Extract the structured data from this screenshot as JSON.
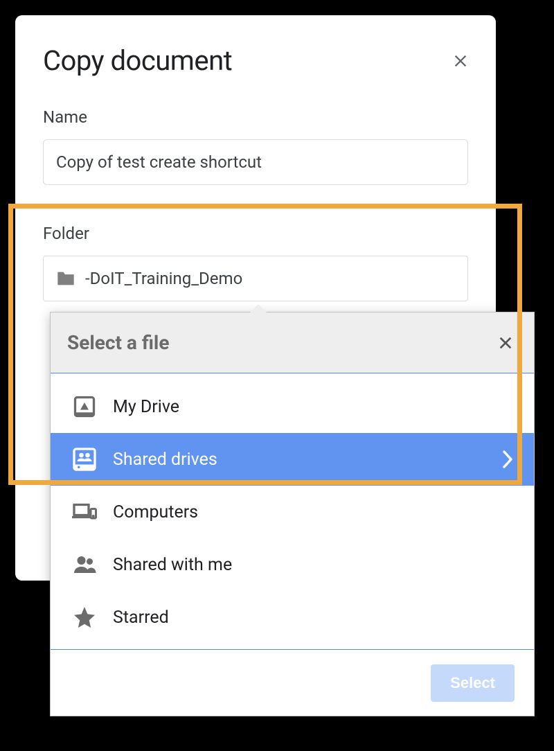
{
  "dialog": {
    "title": "Copy document",
    "name_label": "Name",
    "name_value": "Copy of test create shortcut",
    "folder_label": "Folder",
    "folder_value": "-DoIT_Training_Demo"
  },
  "picker": {
    "title": "Select a file",
    "select_button": "Select",
    "items": [
      {
        "label": "My Drive",
        "icon": "drive-icon",
        "selected": false
      },
      {
        "label": "Shared drives",
        "icon": "shared-drives-icon",
        "selected": true
      },
      {
        "label": "Computers",
        "icon": "computers-icon",
        "selected": false
      },
      {
        "label": "Shared with me",
        "icon": "shared-with-me-icon",
        "selected": false
      },
      {
        "label": "Starred",
        "icon": "star-icon",
        "selected": false
      }
    ]
  }
}
